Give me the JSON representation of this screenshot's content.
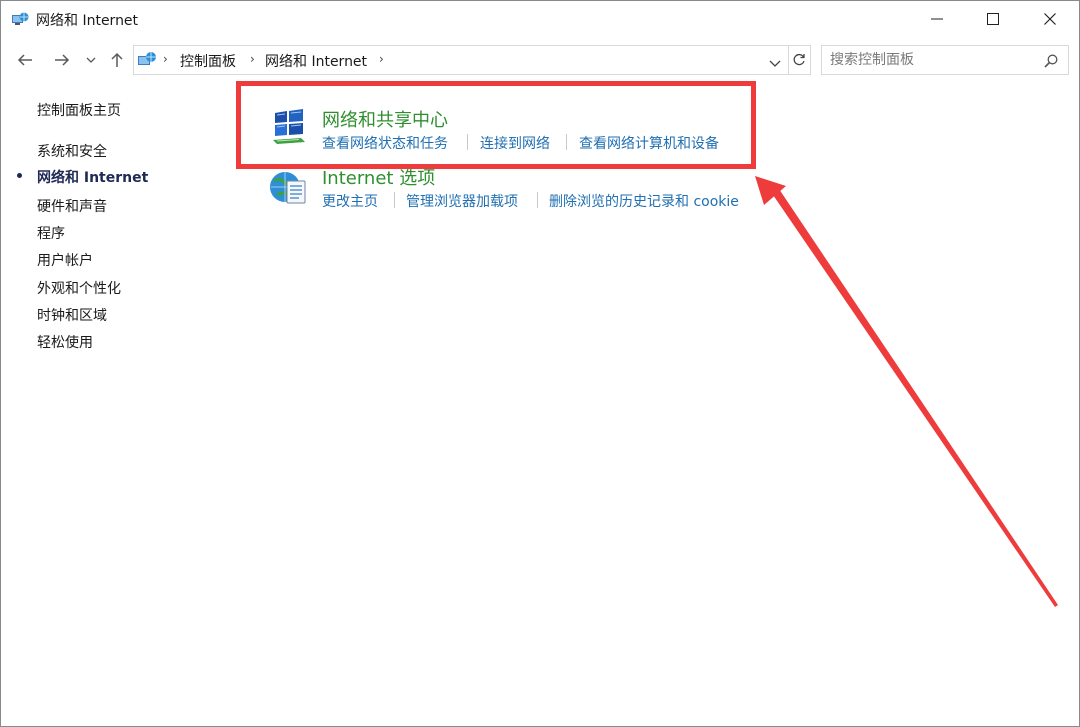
{
  "window": {
    "title": "网络和 Internet",
    "controls": {
      "minimize": "minimize-icon",
      "maximize": "maximize-icon",
      "close": "close-icon"
    }
  },
  "navigation": {
    "back": "arrow-left-icon",
    "forward": "arrow-right-icon",
    "recent": "chevron-down-icon",
    "up": "arrow-up-icon"
  },
  "address": {
    "breadcrumbs": [
      "控制面板",
      "网络和 Internet"
    ],
    "refresh": "refresh-icon"
  },
  "search": {
    "placeholder": "搜索控制面板",
    "value": ""
  },
  "sidebar": {
    "home": "控制面板主页",
    "items": [
      {
        "label": "系统和安全",
        "active": false
      },
      {
        "label": "网络和 Internet",
        "active": true
      },
      {
        "label": "硬件和声音",
        "active": false
      },
      {
        "label": "程序",
        "active": false
      },
      {
        "label": "用户帐户",
        "active": false
      },
      {
        "label": "外观和个性化",
        "active": false
      },
      {
        "label": "时钟和区域",
        "active": false
      },
      {
        "label": "轻松使用",
        "active": false
      }
    ]
  },
  "categories": [
    {
      "title": "网络和共享中心",
      "icon": "network-sharing-center-icon",
      "links": [
        "查看网络状态和任务",
        "连接到网络",
        "查看网络计算机和设备"
      ]
    },
    {
      "title": "Internet 选项",
      "icon": "internet-options-icon",
      "links": [
        "更改主页",
        "管理浏览器加载项",
        "删除浏览的历史记录和 cookie"
      ]
    }
  ],
  "colors": {
    "category_title": "#2f8f2f",
    "link": "#1f6fb2",
    "annotation": "#ee3b3b",
    "active_nav": "#1e2a55"
  }
}
